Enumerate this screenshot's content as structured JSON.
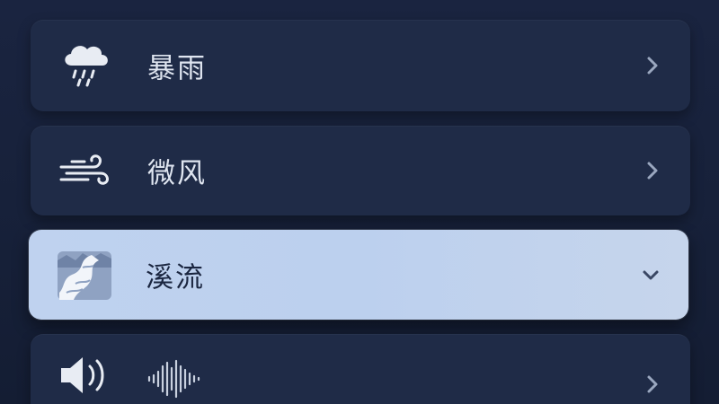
{
  "list": {
    "items": [
      {
        "label": "暴雨",
        "icon": "rain-cloud-icon",
        "state": "collapsed"
      },
      {
        "label": "微风",
        "icon": "wind-icon",
        "state": "collapsed"
      },
      {
        "label": "溪流",
        "icon": "stream-icon",
        "state": "expanded"
      },
      {
        "label": "",
        "icon": "speaker-icon",
        "state": "collapsed"
      }
    ]
  },
  "colors": {
    "background": "#18223a",
    "row": "#1f2b47",
    "selected_row": "#bfd2ef",
    "text": "#dfe5f0"
  }
}
